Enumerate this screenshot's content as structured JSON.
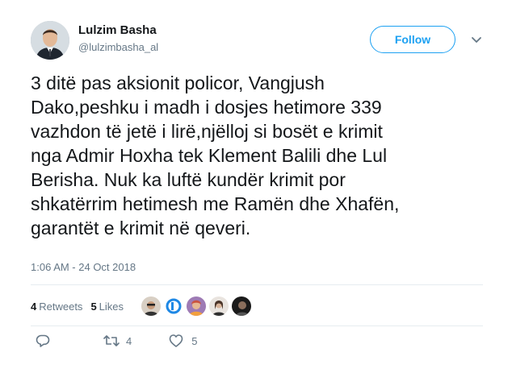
{
  "author": {
    "name": "Lulzim Basha",
    "handle": "@lulzimbasha_al"
  },
  "follow_label": "Follow",
  "tweet": {
    "text": "3 ditë pas aksionit policor, Vangjush\nDako,peshku i madh i dosjes hetimore 339\nvazhdon të jetë i lirë,njëlloj si bosët e krimit\nnga Admir Hoxha tek Klement Balili dhe Lul\nBerisha. Nuk ka luftë kundër krimit por\nshkatërrim hetimesh me Ramën dhe Xhafën,\ngarantët e krimit në qeveri.",
    "timestamp": "1:06 AM - 24 Oct 2018"
  },
  "stats": {
    "retweets_count": "4",
    "retweets_label": "Retweets",
    "likes_count": "5",
    "likes_label": "Likes"
  },
  "actions": {
    "reply_count": "",
    "retweet_count": "4",
    "like_count": "5"
  },
  "icons": [
    "chevron-down-icon",
    "reply-icon",
    "retweet-icon",
    "heart-icon"
  ],
  "colors": {
    "accent": "#1da1f2",
    "secondary_text": "#657786",
    "divider": "#e6ecf0",
    "primary_text": "#14171a"
  }
}
